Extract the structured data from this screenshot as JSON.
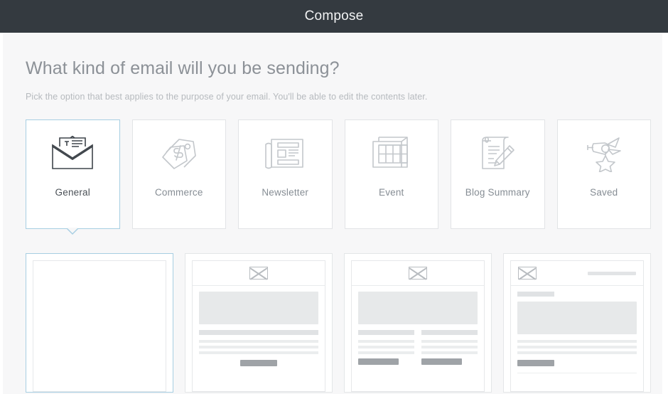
{
  "window": {
    "title": "Compose"
  },
  "colors": {
    "titlebar_bg": "#343a40",
    "page_bg": "#f7f7f8",
    "accent_selected": "#a7cee2",
    "heading_text": "#8c9197",
    "sub_text": "#b6babe",
    "card_border": "#e2e4e6",
    "label_text": "#868d94",
    "label_text_selected": "#4b5157"
  },
  "main": {
    "heading": "What kind of email will you be sending?",
    "subheading": "Pick the option that best applies to the purpose of your email. You'll be able to edit the contents later."
  },
  "categories": [
    {
      "id": "general",
      "label": "General",
      "icon": "open-envelope-letter-icon",
      "selected": true
    },
    {
      "id": "commerce",
      "label": "Commerce",
      "icon": "price-tags-dollar-icon",
      "selected": false
    },
    {
      "id": "newsletter",
      "label": "Newsletter",
      "icon": "newspaper-icon",
      "selected": false
    },
    {
      "id": "event",
      "label": "Event",
      "icon": "calendar-grid-icon",
      "selected": false
    },
    {
      "id": "blog-summary",
      "label": "Blog Summary",
      "icon": "scroll-pencil-icon",
      "selected": false
    },
    {
      "id": "saved",
      "label": "Saved",
      "icon": "award-ribbon-star-icon",
      "selected": false
    }
  ],
  "templates": [
    {
      "id": "blank",
      "layout": "blank",
      "selected": true
    },
    {
      "id": "single-column",
      "layout": "one-column",
      "selected": false
    },
    {
      "id": "two-column",
      "layout": "two-column",
      "selected": false
    },
    {
      "id": "left-logo-nav",
      "layout": "left-logo",
      "selected": false
    }
  ]
}
